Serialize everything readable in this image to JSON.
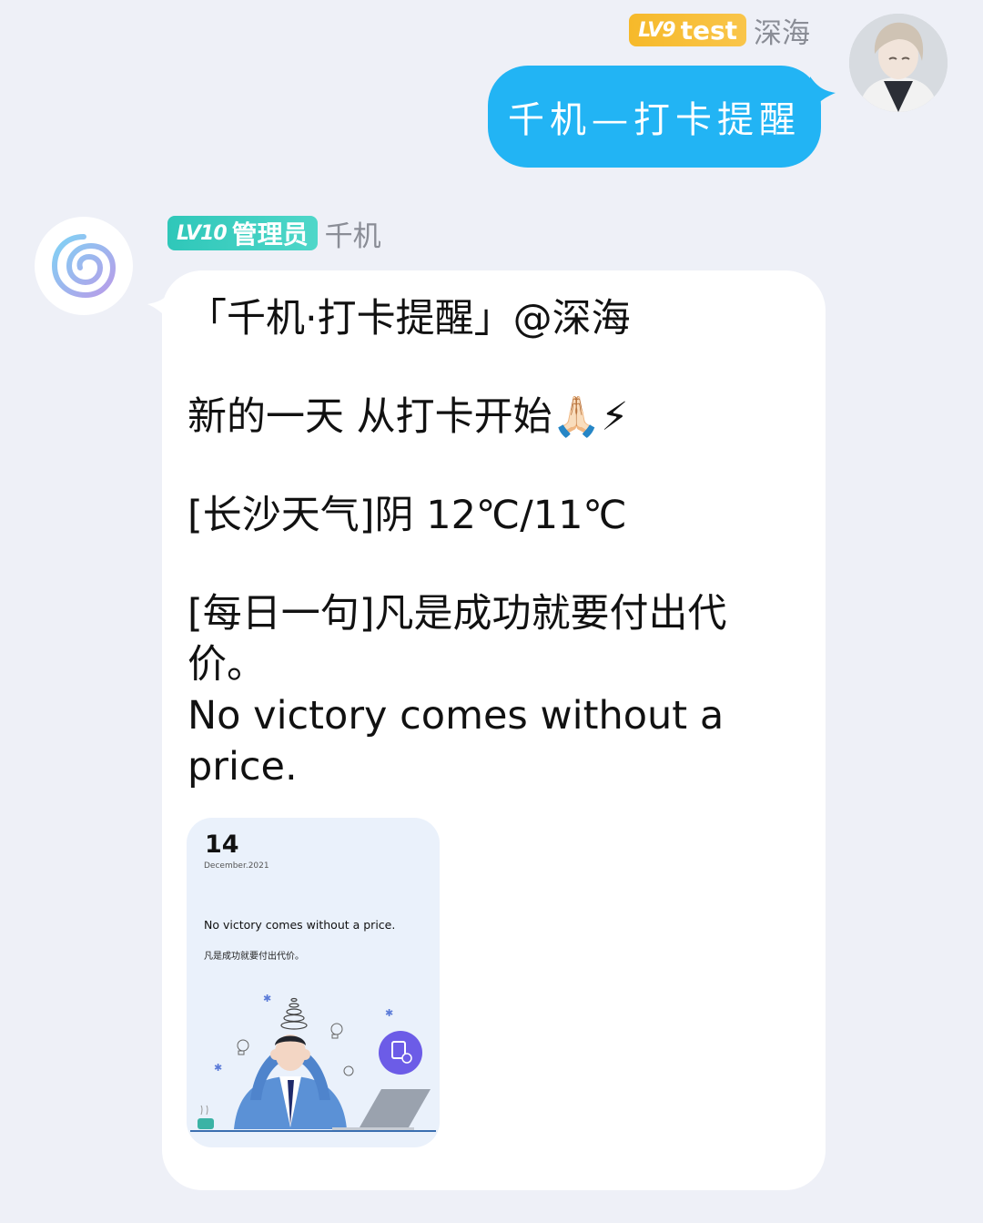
{
  "outgoing": {
    "badge_level": "LV9",
    "badge_title": "test",
    "nickname": "深海",
    "text": "千机—打卡提醒"
  },
  "incoming": {
    "badge_level": "LV10",
    "badge_title": "管理员",
    "nickname": "千机",
    "lines": {
      "title": "「千机·打卡提醒」@深海",
      "greeting": "新的一天 从打卡开始🙏🏻⚡",
      "weather": "[长沙天气]阴 12℃/11℃",
      "quote_cn": "[每日一句]凡是成功就要付出代价。",
      "quote_en": "No victory comes without a price."
    },
    "card": {
      "day": "14",
      "month": "December.2021",
      "quote_en": "No victory comes without a price.",
      "quote_cn": "凡是成功就要付出代价。"
    }
  },
  "colors": {
    "background": "#eef0f7",
    "outgoing_bubble": "#22b4f4",
    "badge_gold": "#f6b92a",
    "badge_teal": "#2fc7b9"
  },
  "icons": {
    "bot_avatar": "spiral-logo-icon",
    "user_avatar": "anime-avatar"
  }
}
